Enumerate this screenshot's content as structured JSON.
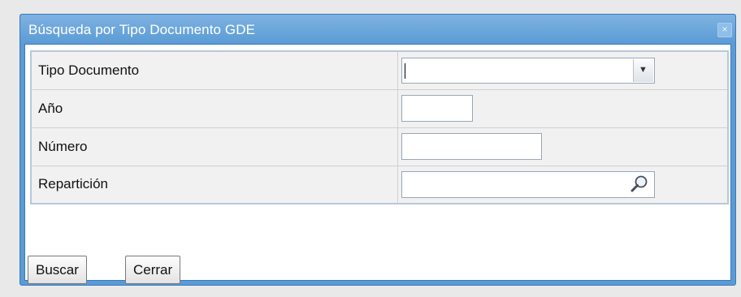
{
  "dialog": {
    "title": "Búsqueda por Tipo Documento GDE",
    "close_label": "×"
  },
  "form": {
    "rows": [
      {
        "label": "Tipo Documento",
        "value": ""
      },
      {
        "label": "Año",
        "value": ""
      },
      {
        "label": "Número",
        "value": ""
      },
      {
        "label": "Repartición",
        "value": ""
      }
    ]
  },
  "actions": {
    "search_label": "Buscar",
    "close_label": "Cerrar"
  },
  "icons": {
    "dropdown": "chevron-down-icon",
    "lookup": "magnifier-icon"
  },
  "colors": {
    "titlebar": "#5b9bd5",
    "accent_border": "#3a79ba"
  }
}
